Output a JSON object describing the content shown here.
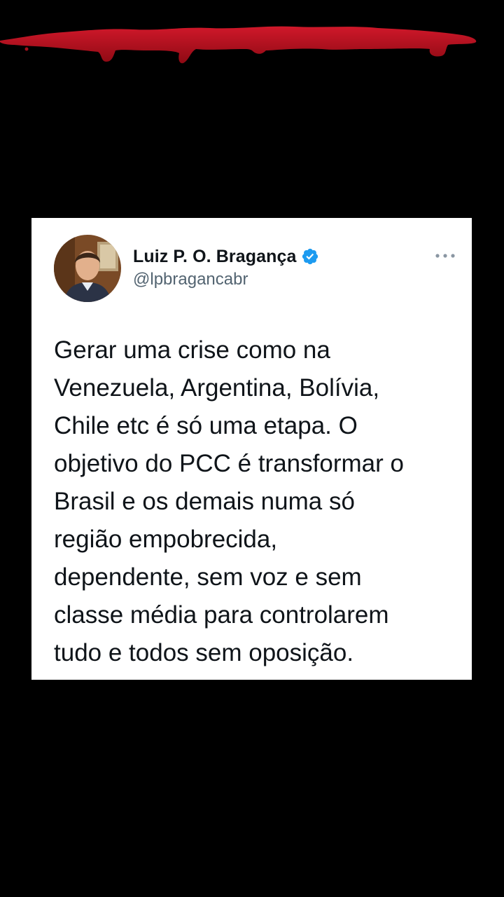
{
  "tweet": {
    "display_name": "Luiz P. O. Bragança",
    "handle": "@lpbragancabr",
    "lines": [
      "Gerar uma crise como na",
      "Venezuela, Argentina, Bolívia,",
      "Chile etc é só uma etapa. O",
      "objetivo do PCC é transformar o",
      "Brasil e os demais numa só",
      "região empobrecida,",
      "dependente, sem voz e sem",
      "classe média para controlarem",
      "tudo e todos sem oposição."
    ],
    "verified": true
  },
  "icons": {
    "verified": "verified-badge-icon",
    "more": "more-options-icon",
    "decoration": "blood-drip-decoration"
  },
  "colors": {
    "background": "#000000",
    "card": "#ffffff",
    "text_primary": "#0f1419",
    "text_secondary": "#536471",
    "verified_blue": "#1d9bf0",
    "blood_red": "#b0101c"
  }
}
